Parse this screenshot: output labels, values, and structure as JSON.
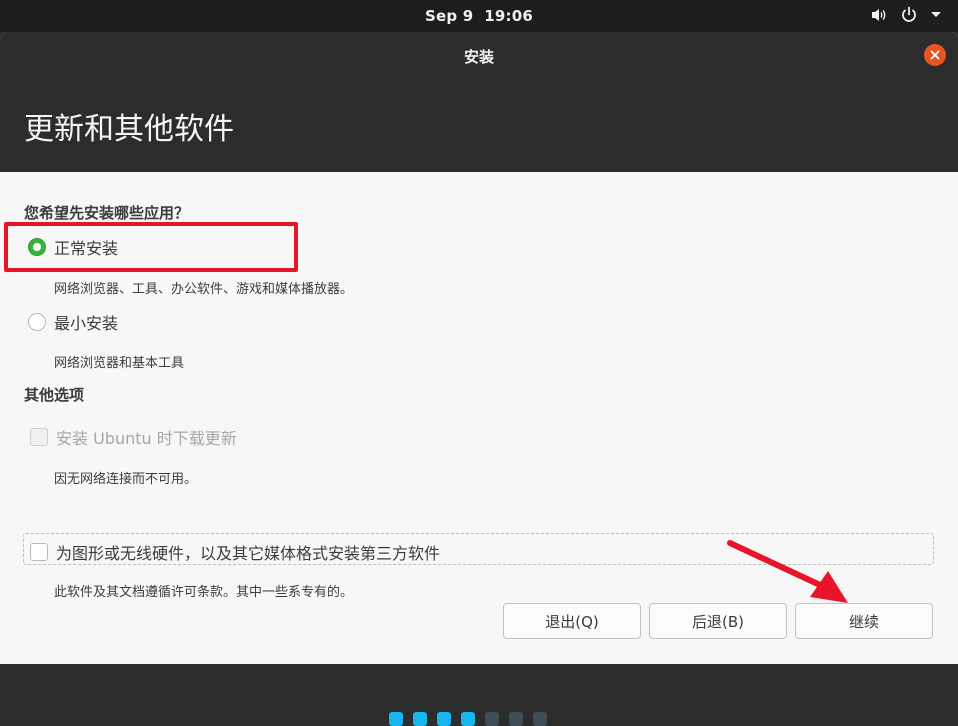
{
  "system": {
    "date": "Sep 9",
    "time": "19:06"
  },
  "window": {
    "title": "安装"
  },
  "page": {
    "title": "更新和其他软件"
  },
  "install_question": "您希望先安装哪些应用？",
  "options": {
    "normal": {
      "label": "正常安装",
      "desc": "网络浏览器、工具、办公软件、游戏和媒体播放器。",
      "selected": true
    },
    "minimal": {
      "label": "最小安装",
      "desc": "网络浏览器和基本工具",
      "selected": false
    }
  },
  "other_section": "其他选项",
  "updates": {
    "label": "安装 Ubuntu 时下载更新",
    "desc": "因无网络连接而不可用。",
    "disabled": true
  },
  "third_party": {
    "label": "为图形或无线硬件，以及其它媒体格式安装第三方软件",
    "desc": "此软件及其文档遵循许可条款。其中一些系专有的。"
  },
  "buttons": {
    "quit": "退出(Q)",
    "back": "后退(B)",
    "continue": "继续"
  },
  "progress": {
    "active": 4,
    "total": 7
  },
  "colors": {
    "accent": "#e95420",
    "radio_selected": "#3cb23c",
    "annotation": "#e8152a",
    "progress_active": "#19b6ee"
  },
  "icons": [
    "volume-icon",
    "power-icon",
    "chevron-down-icon",
    "close-icon"
  ]
}
